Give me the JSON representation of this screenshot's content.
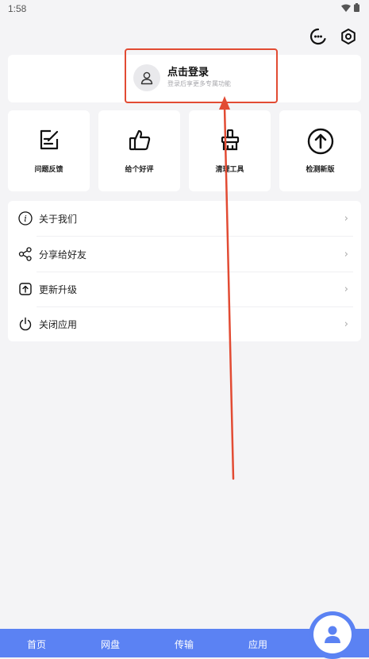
{
  "status": {
    "time": "1:58"
  },
  "login": {
    "title": "点击登录",
    "subtitle": "登录后享更多专属功能"
  },
  "tools": [
    {
      "label": "问题反馈",
      "icon": "feedback-icon"
    },
    {
      "label": "给个好评",
      "icon": "thumbs-up-icon"
    },
    {
      "label": "清理工具",
      "icon": "broom-icon"
    },
    {
      "label": "检测新版",
      "icon": "arrow-up-circle-icon"
    }
  ],
  "menu": [
    {
      "label": "关于我们",
      "icon": "info-icon"
    },
    {
      "label": "分享给好友",
      "icon": "share-icon"
    },
    {
      "label": "更新升级",
      "icon": "update-icon"
    },
    {
      "label": "关闭应用",
      "icon": "power-icon"
    }
  ],
  "nav": {
    "home": "首页",
    "drive": "网盘",
    "transfer": "传输",
    "apps": "应用"
  },
  "colors": {
    "accent": "#5b82f3",
    "annotation": "#e24b33"
  }
}
